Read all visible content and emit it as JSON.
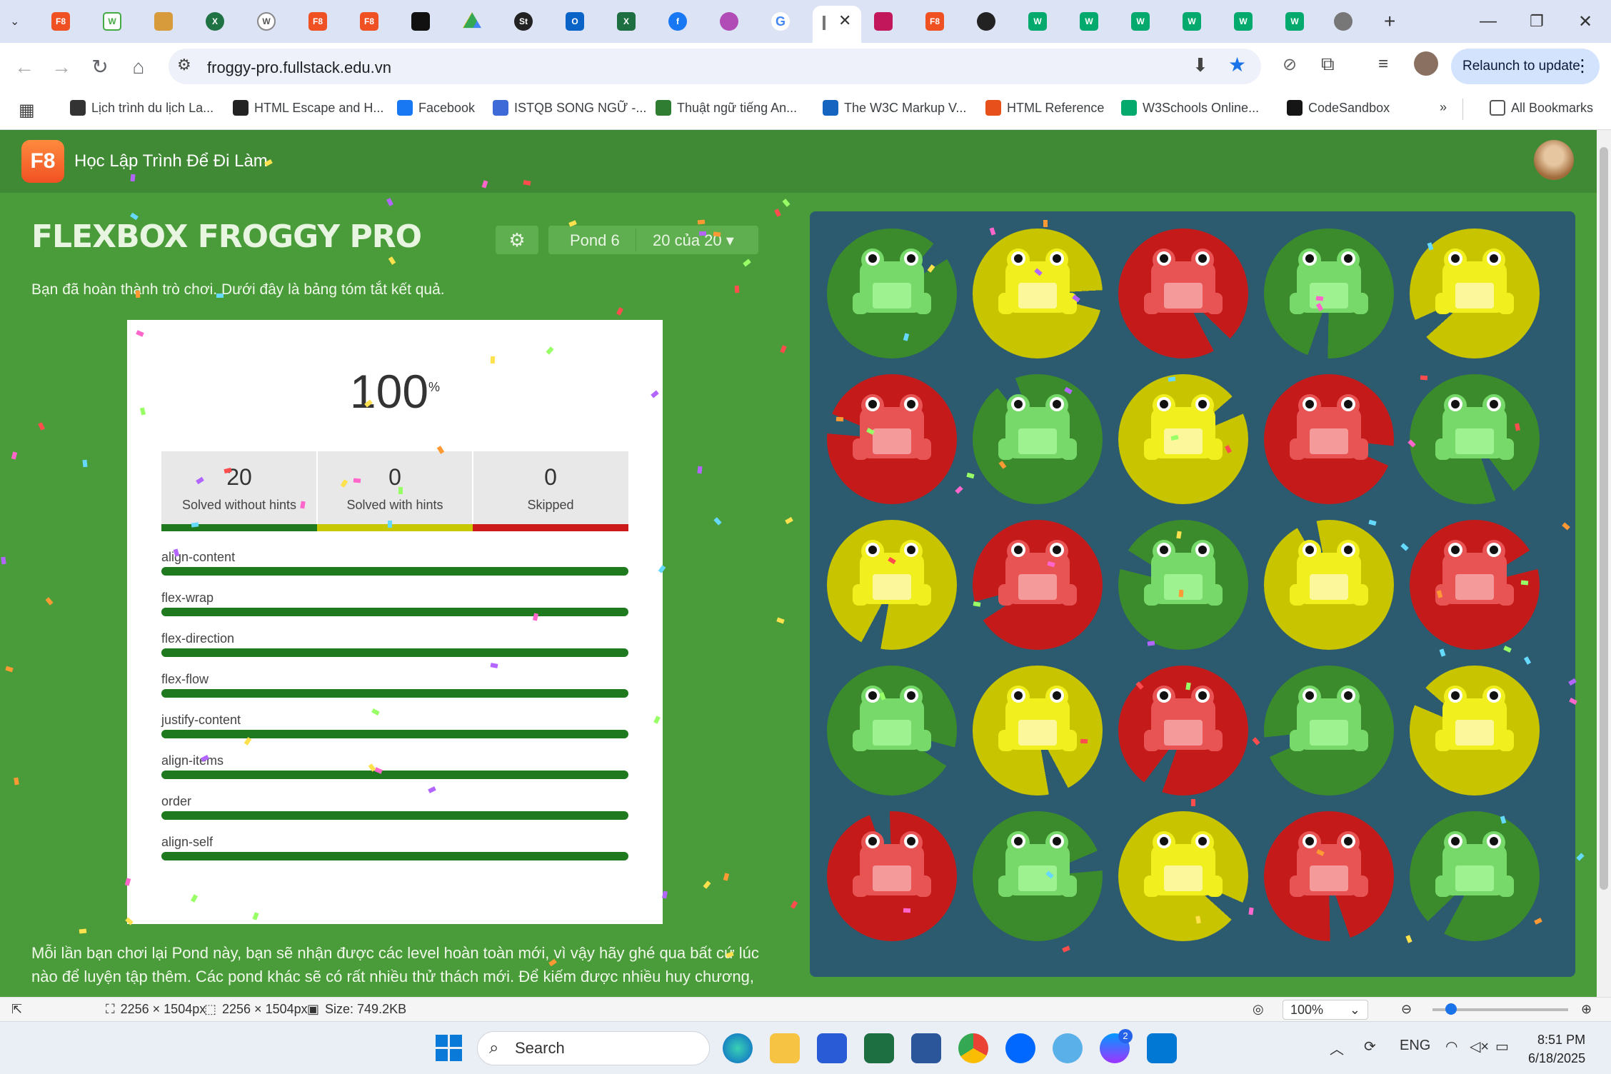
{
  "browser": {
    "url": "froggy-pro.fullstack.edu.vn",
    "relaunch_label": "Relaunch to update",
    "bookmarks": [
      {
        "label": "Lịch trình du lịch La...",
        "color": "#333333"
      },
      {
        "label": "HTML Escape and H...",
        "color": "#222222"
      },
      {
        "label": "Facebook",
        "color": "#1877f2"
      },
      {
        "label": "ISTQB SONG NGỮ -...",
        "color": "#3d6ad6"
      },
      {
        "label": "Thuật ngữ tiếng An...",
        "color": "#2e7d32"
      },
      {
        "label": "The W3C Markup V...",
        "color": "#1565c0"
      },
      {
        "label": "HTML Reference",
        "color": "#e8501b"
      },
      {
        "label": "W3Schools Online...",
        "color": "#04aa6d"
      },
      {
        "label": "CodeSandbox",
        "color": "#151515"
      }
    ],
    "all_bookmarks": "All Bookmarks",
    "more_chevron": "»"
  },
  "site": {
    "logo": "F8",
    "title": "Học Lập Trình Để Đi Làm"
  },
  "game": {
    "title": "FLEXBOX FROGGY PRO",
    "pond": "Pond 6",
    "level": "20 của 20",
    "intro": "Bạn đã hoàn thành trò chơi. Dưới đây là bảng tóm tắt kết quả.",
    "percent": "100",
    "percent_sign": "%",
    "stats": [
      {
        "value": "20",
        "label": "Solved without hints",
        "color": "#1f7a1f"
      },
      {
        "value": "0",
        "label": "Solved with hints",
        "color": "#c8c800"
      },
      {
        "value": "0",
        "label": "Skipped",
        "color": "#cc1a1a"
      }
    ],
    "properties": [
      {
        "name": "align-content",
        "progress": 1.0
      },
      {
        "name": "flex-wrap",
        "progress": 1.0
      },
      {
        "name": "flex-direction",
        "progress": 1.0
      },
      {
        "name": "flex-flow",
        "progress": 1.0
      },
      {
        "name": "justify-content",
        "progress": 1.0
      },
      {
        "name": "align-items",
        "progress": 1.0
      },
      {
        "name": "order",
        "progress": 1.0
      },
      {
        "name": "align-self",
        "progress": 1.0
      }
    ],
    "outro": "Mỗi lần bạn chơi lại Pond này, bạn sẽ nhận được các level hoàn toàn mới, vì vậy hãy ghé qua bất cứ lúc nào để luyện tập thêm. Các pond khác sẽ có rất nhiều thử thách mới. Để kiếm được nhiều huy chương,",
    "board": [
      [
        "green",
        "yellow",
        "red",
        "green",
        "yellow"
      ],
      [
        "red",
        "green",
        "yellow",
        "red",
        "green"
      ],
      [
        "yellow",
        "red",
        "green",
        "yellow",
        "red"
      ],
      [
        "green",
        "yellow",
        "red",
        "green",
        "yellow"
      ],
      [
        "red",
        "green",
        "yellow",
        "red",
        "green"
      ]
    ],
    "colors": {
      "green": {
        "pad": "#3b8a2c",
        "frog": "#76d96a",
        "belly": "#9ef28f"
      },
      "yellow": {
        "pad": "#c8c400",
        "frog": "#f2ef1e",
        "belly": "#fbf79a"
      },
      "red": {
        "pad": "#c41a1a",
        "frog": "#e85454",
        "belly": "#f59a9a"
      }
    }
  },
  "statusbar": {
    "dims1": "2256 × 1504px",
    "dims2": "2256 × 1504px",
    "size": "Size: 749.2KB",
    "zoom": "100%"
  },
  "taskbar": {
    "search_placeholder": "Search",
    "lang": "ENG",
    "time": "8:51 PM",
    "date": "6/18/2025",
    "messenger_badge": "2"
  }
}
